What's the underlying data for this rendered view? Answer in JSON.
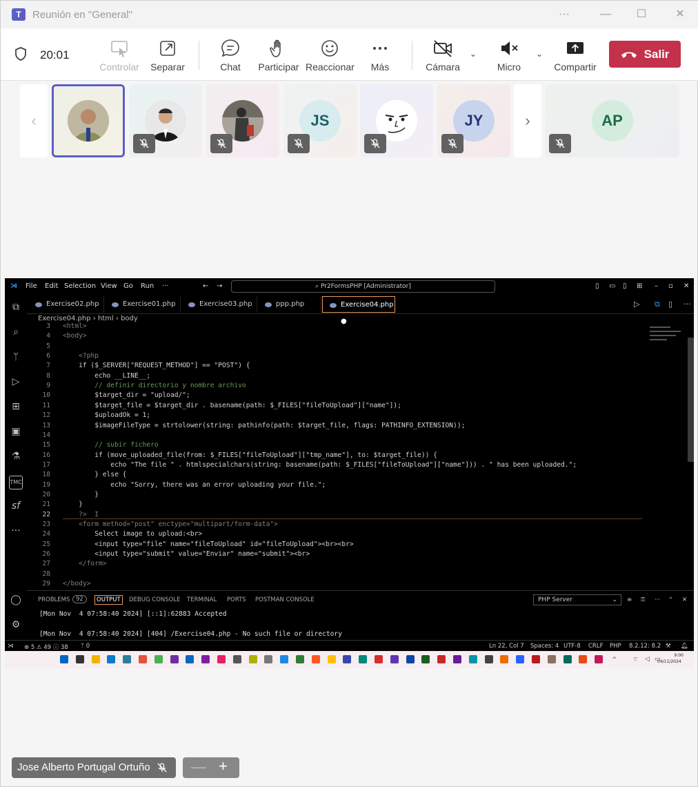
{
  "window": {
    "title": "Reunión en \"General\"",
    "app_logo": "T"
  },
  "toolbar": {
    "timer": "20:01",
    "control_label": "Controlar",
    "popout_label": "Separar",
    "chat_label": "Chat",
    "raise_label": "Participar",
    "react_label": "Reaccionar",
    "more_label": "Más",
    "camera_label": "Cámara",
    "mic_label": "Micro",
    "share_label": "Compartir",
    "leave_label": "Salir",
    "leave_color": "#c4314b"
  },
  "participants": [
    {
      "initials": "",
      "type": "photo",
      "muted": false,
      "selected": true
    },
    {
      "initials": "",
      "type": "photo",
      "muted": true
    },
    {
      "initials": "",
      "type": "photo",
      "muted": true
    },
    {
      "initials": "JS",
      "type": "initials",
      "muted": true
    },
    {
      "initials": "",
      "type": "meme-face",
      "muted": true
    },
    {
      "initials": "JY",
      "type": "initials",
      "muted": true
    },
    {
      "initials": "AP",
      "type": "initials",
      "muted": true
    }
  ],
  "vscode": {
    "menu": [
      "File",
      "Edit",
      "Selection",
      "View",
      "Go",
      "Run",
      "···"
    ],
    "search": "Pr2FormsPHP [Administrator]",
    "tabs": [
      "Exercise02.php",
      "Exercise01.php",
      "Exercise03.php",
      "ppp.php",
      "Exercise04.php"
    ],
    "active_tab_marker": "●",
    "breadcrumb": [
      "Exercise04.php",
      "html",
      "body"
    ],
    "line_numbers": [
      "3",
      "4",
      "5",
      "6",
      "7",
      "8",
      "9",
      "10",
      "11",
      "12",
      "13",
      "14",
      "15",
      "16",
      "17",
      "18",
      "19",
      "20",
      "21",
      "22",
      "23",
      "24",
      "25",
      "26",
      "27",
      "28",
      "29"
    ],
    "code_lines": [
      "<html>",
      "<body>",
      "",
      "    <?php",
      "    if ($_SERVER[\"REQUEST_METHOD\"] == \"POST\") {",
      "        echo __LINE__;",
      "        // definir directorio y nombre archivo",
      "        $target_dir = \"upload/\";",
      "        $target_file = $target_dir . basename(path: $_FILES[\"fileToUpload\"][\"name\"]);",
      "        $uploadOk = 1;",
      "        $imageFileType = strtolower(string: pathinfo(path: $target_file, flags: PATHINFO_EXTENSION));",
      "",
      "        // subir fichero",
      "        if (move_uploaded_file(from: $_FILES[\"fileToUpload\"][\"tmp_name\"], to: $target_file)) {",
      "            echo \"The file \" . htmlspecialchars(string: basename(path: $_FILES[\"fileToUpload\"][\"name\"])) . \" has been uploaded.\";",
      "        } else {",
      "            echo \"Sorry, there was an error uploading your file.\";",
      "        }",
      "    }",
      "    ?>  I",
      "    <form method=\"post\" enctype=\"multipart/form-data\">",
      "        Select image to upload:<br>",
      "        <input type=\"file\" name=\"fileToUpload\" id=\"fileToUpload\"><br><br>",
      "        <input type=\"submit\" value=\"Enviar\" name=\"submit\"><br>",
      "    </form>",
      "",
      "</body>"
    ],
    "panel_tabs": [
      "PROBLEMS",
      "92",
      "OUTPUT",
      "DEBUG CONSOLE",
      "TERMINAL",
      "PORTS",
      "POSTMAN CONSOLE"
    ],
    "panel_dropdown": "PHP Server",
    "output_lines": [
      "[Mon Nov  4 07:58:40 2024] [::1]:62883 Accepted",
      "",
      "[Mon Nov  4 07:58:40 2024] [404] /Exercise04.php - No such file or directory"
    ],
    "status_left": [
      "⊗ 5 ⚠ 49 ⓘ 38",
      "ᛘ 0"
    ],
    "status_right": [
      "Ln 22, Col 7",
      "Spaces: 4",
      "UTF-8",
      "CRLF",
      "PHP",
      "8.2.12: 8.2"
    ],
    "taskbar_time": "9:00",
    "taskbar_date": "04/11/2024"
  },
  "bottom": {
    "presenter_name": "Jose Alberto Portugal Ortuño",
    "zoom_out": "—",
    "zoom_in": "+"
  }
}
